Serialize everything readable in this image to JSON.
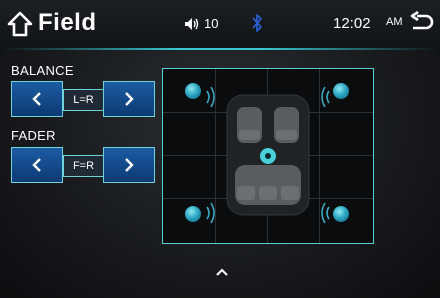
{
  "header": {
    "title": "Field",
    "volume": "10",
    "time": "12:02",
    "ampm": "AM"
  },
  "balance": {
    "label": "BALANCE",
    "value": "L=R"
  },
  "fader": {
    "label": "FADER",
    "value": "F=R"
  },
  "colors": {
    "accent": "#38c6d0",
    "button": "#1c5ca3",
    "bluetooth": "#2a63d8"
  },
  "icons": [
    "home-icon",
    "volume-icon",
    "bluetooth-icon",
    "back-icon",
    "left-arrow-icon",
    "right-arrow-icon",
    "car-seats-icon",
    "speaker-icon",
    "chevron-up-icon"
  ]
}
